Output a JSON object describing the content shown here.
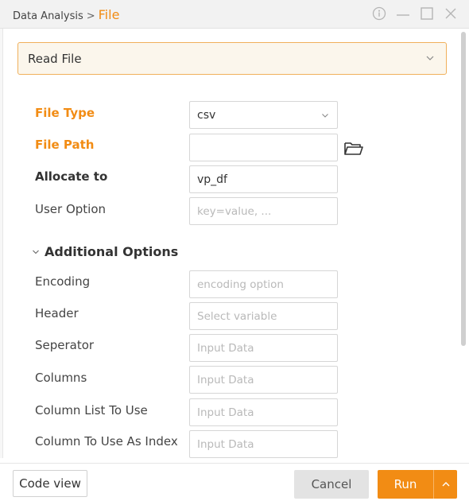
{
  "titlebar": {
    "breadcrumb_parent": "Data Analysis",
    "breadcrumb_sep": ">",
    "breadcrumb_current": "File",
    "icons": [
      "info-icon",
      "minimize-icon",
      "maximize-icon",
      "close-icon"
    ]
  },
  "mode_select": {
    "selected": "Read File",
    "icon": "chevron-down-icon"
  },
  "form": {
    "file_type": {
      "label": "File Type",
      "value": "csv"
    },
    "file_path": {
      "label": "File Path",
      "value": ""
    },
    "allocate_to": {
      "label": "Allocate to",
      "value": "vp_df"
    },
    "user_option": {
      "label": "User Option",
      "placeholder": "key=value, ..."
    }
  },
  "additional": {
    "title": "Additional Options",
    "rows": [
      {
        "label": "Encoding",
        "placeholder": "encoding option"
      },
      {
        "label": "Header",
        "placeholder": "Select variable"
      },
      {
        "label": "Seperator",
        "placeholder": "Input Data"
      },
      {
        "label": "Columns",
        "placeholder": "Input Data"
      },
      {
        "label": "Column List To Use",
        "placeholder": "Input Data"
      },
      {
        "label": "Column To Use As Index",
        "placeholder": "Input Data"
      }
    ]
  },
  "footer": {
    "code_view": "Code view",
    "cancel": "Cancel",
    "run": "Run"
  },
  "colors": {
    "accent": "#f28c14",
    "required_label": "#f28c14",
    "dropdown_bg": "#fbf6ec",
    "dropdown_border": "#f0b05b"
  }
}
